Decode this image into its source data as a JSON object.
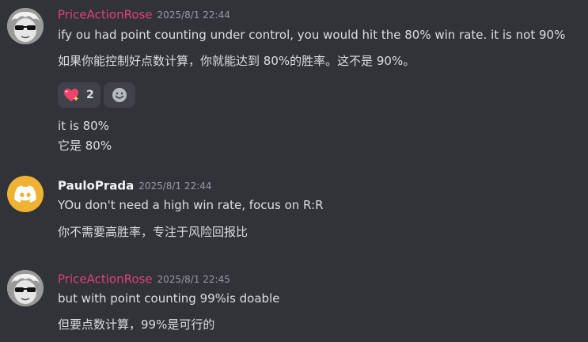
{
  "messages": [
    {
      "username": "PriceActionRose",
      "timestamp": "2025/8/1 22:44",
      "lines": [
        "ify ou had point counting under control, you would hit the 80% win rate. it is not 90%",
        "如果你能控制好点数计算，你就能达到 80%的胜率。这不是 90%。"
      ],
      "reactions": [
        {
          "icon": "sparkling-heart-emoji",
          "count": "2"
        }
      ],
      "add_reaction_icon": "smiley-icon",
      "followup_lines": [
        "it is 80%",
        "它是 80%"
      ]
    },
    {
      "username": "PauloPrada",
      "timestamp": "2025/8/1 22:44",
      "lines": [
        "YOu don't need a high win rate, focus on R:R",
        "你不需要高胜率，专注于风险回报比"
      ]
    },
    {
      "username": "PriceActionRose",
      "timestamp": "2025/8/1 22:45",
      "lines": [
        "but with point counting 99%is doable",
        "但要点数计算，99%是可行的"
      ]
    }
  ],
  "colors": {
    "background": "#313338",
    "username_rose": "#e0407a",
    "username_paulo": "#f2f3f5",
    "text": "#dbdee1",
    "timestamp": "#949ba4",
    "discord_avatar_bg": "#f0b232"
  }
}
